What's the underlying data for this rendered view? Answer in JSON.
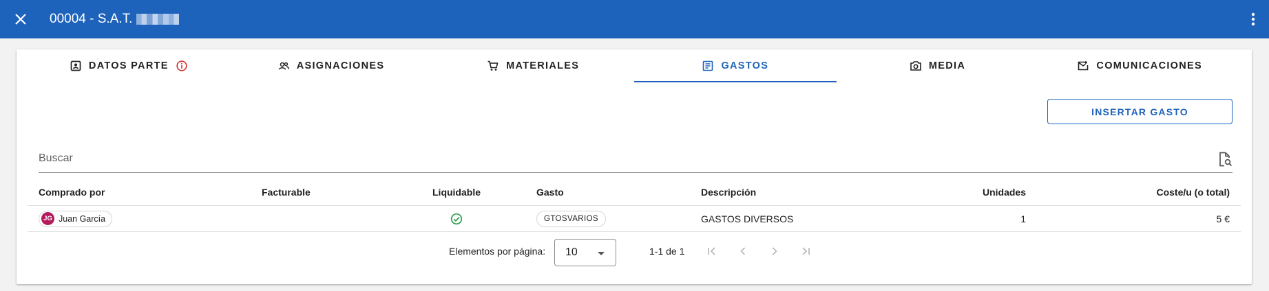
{
  "topbar": {
    "title": "00004 - S.A.T.",
    "close_icon": "close-icon",
    "more_icon": "more-vertical-icon",
    "color": "#1e63bb"
  },
  "tabs": [
    {
      "label": "DATOS PARTE",
      "icon": "contact-card-icon",
      "badge_icon": "info-icon",
      "badge_color": "#d32f2f"
    },
    {
      "label": "ASIGNACIONES",
      "icon": "group-icon"
    },
    {
      "label": "MATERIALES",
      "icon": "cart-icon"
    },
    {
      "label": "GASTOS",
      "icon": "receipt-icon",
      "active": true
    },
    {
      "label": "MEDIA",
      "icon": "camera-icon"
    },
    {
      "label": "COMUNICACIONES",
      "icon": "mail-icon"
    }
  ],
  "actions": {
    "insert_label": "INSERTAR GASTO"
  },
  "search": {
    "placeholder": "Buscar",
    "value": "",
    "icon": "document-search-icon"
  },
  "table": {
    "columns": [
      "Comprado por",
      "Facturable",
      "Liquidable",
      "Gasto",
      "Descripción",
      "Unidades",
      "Coste/u (o total)"
    ],
    "rows": [
      {
        "comprado_por": {
          "initials": "JG",
          "name": "Juan García",
          "avatar_color": "#b3195c"
        },
        "facturable": false,
        "liquidable": true,
        "gasto": "GTOSVARIOS",
        "descripcion": "GASTOS DIVERSOS",
        "unidades": "1",
        "coste": "5 €"
      }
    ],
    "check_color": "#2e9e4f"
  },
  "paginator": {
    "page_size_label": "Elementos por página:",
    "page_size": "10",
    "range": "1-1 de 1"
  }
}
